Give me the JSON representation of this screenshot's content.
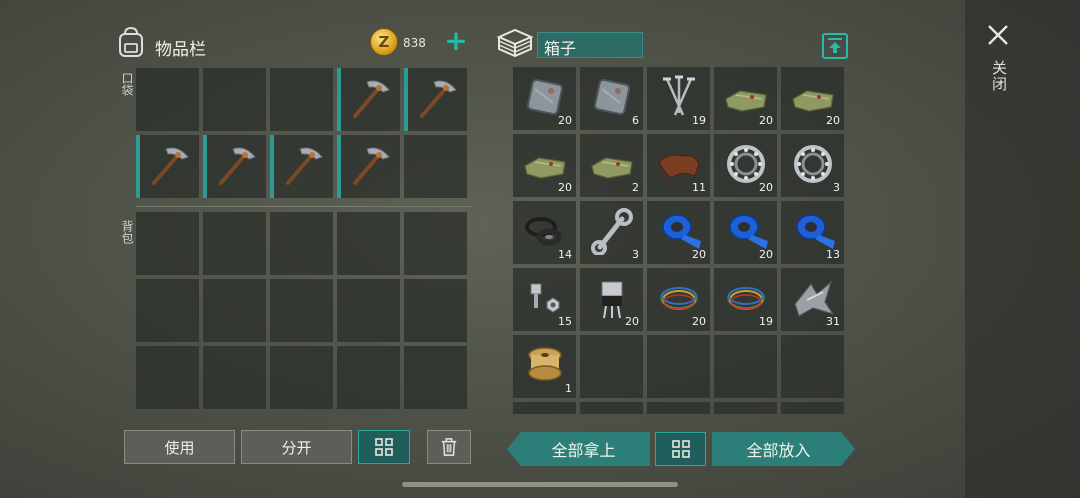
{
  "inventory": {
    "title": "物品栏",
    "pocket_label": "口袋",
    "backpack_label": "背包"
  },
  "currency": {
    "amount": "838",
    "symbol": "Z"
  },
  "chest": {
    "title": "箱子"
  },
  "close": {
    "label": "关闭"
  },
  "actions": {
    "use": "使用",
    "split": "分开",
    "take_all": "全部拿上",
    "put_all": "全部放入"
  },
  "pockets": [
    {
      "item": "",
      "eq": false
    },
    {
      "item": "",
      "eq": false
    },
    {
      "item": "",
      "eq": false
    },
    {
      "item": "pickaxe-icon",
      "eq": true
    },
    {
      "item": "pickaxe-icon",
      "eq": true
    },
    {
      "item": "pickaxe-icon",
      "eq": true
    },
    {
      "item": "pickaxe-icon",
      "eq": true
    },
    {
      "item": "pickaxe-icon",
      "eq": true
    },
    {
      "item": "pickaxe-icon",
      "eq": true
    },
    {
      "item": "",
      "eq": false
    }
  ],
  "chest_items": [
    {
      "item": "metal-plate-icon",
      "count": "20"
    },
    {
      "item": "metal-plate-icon",
      "count": "6"
    },
    {
      "item": "nails-icon",
      "count": "19"
    },
    {
      "item": "cloth-icon",
      "count": "20"
    },
    {
      "item": "cloth-icon",
      "count": "20"
    },
    {
      "item": "cloth-icon",
      "count": "20"
    },
    {
      "item": "cloth-icon",
      "count": "2"
    },
    {
      "item": "leather-icon",
      "count": "11"
    },
    {
      "item": "bearing-icon",
      "count": "20"
    },
    {
      "item": "bearing-icon",
      "count": "3"
    },
    {
      "item": "rubber-seals-icon",
      "count": "14"
    },
    {
      "item": "wrench-icon",
      "count": "3"
    },
    {
      "item": "blue-tape-icon",
      "count": "20"
    },
    {
      "item": "blue-tape-icon",
      "count": "20"
    },
    {
      "item": "blue-tape-icon",
      "count": "13"
    },
    {
      "item": "bolt-nut-icon",
      "count": "15"
    },
    {
      "item": "transistor-icon",
      "count": "20"
    },
    {
      "item": "wires-icon",
      "count": "20"
    },
    {
      "item": "wires-icon",
      "count": "19"
    },
    {
      "item": "scrap-metal-icon",
      "count": "31"
    },
    {
      "item": "wire-spool-icon",
      "count": "1"
    }
  ],
  "colors": {
    "accent": "#2b7f78",
    "accent_border": "#2aa99c",
    "slot_bg": "#2c302c"
  }
}
